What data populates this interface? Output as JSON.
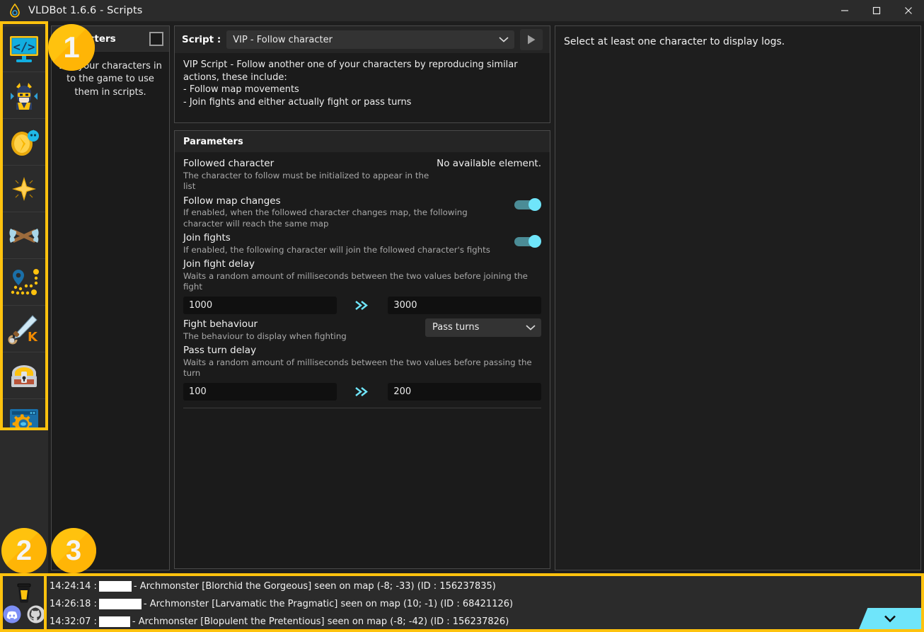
{
  "window": {
    "title": "VLDBot 1.6.6 - Scripts",
    "app_icon": "droplet-icon",
    "minimize_label": "—",
    "maximize_label": "□",
    "close_label": "✕"
  },
  "colors": {
    "accent_yellow": "#FFC20E",
    "accent_cyan": "#6FE5FA",
    "panel_bg": "#1B1B1B",
    "window_bg": "#1E1E1E",
    "header_bg": "#2B2B2B"
  },
  "sidebar": {
    "items": [
      {
        "id": "scripts",
        "label": "Scripts",
        "icon": "code-monitor-icon",
        "selected": true
      },
      {
        "id": "characters",
        "label": "Characters",
        "icon": "character-helmet-icon",
        "selected": false
      },
      {
        "id": "resources",
        "label": "Resources",
        "icon": "golden-egg-icon",
        "selected": false
      },
      {
        "id": "achievements",
        "label": "Achievements",
        "icon": "star-burst-icon",
        "selected": false
      },
      {
        "id": "fights",
        "label": "Fights",
        "icon": "crossed-axes-icon",
        "selected": false
      },
      {
        "id": "paths",
        "label": "Paths",
        "icon": "map-pin-path-icon",
        "selected": false
      },
      {
        "id": "kolizeum",
        "label": "Kolizeum",
        "icon": "sword-k-icon",
        "selected": false
      },
      {
        "id": "inventory",
        "label": "Inventory",
        "icon": "treasure-chest-icon",
        "selected": false
      },
      {
        "id": "settings",
        "label": "Settings",
        "icon": "window-gear-icon",
        "selected": false
      }
    ],
    "social": [
      {
        "id": "donate",
        "label": "Buy me a coffee",
        "icon": "coffee-cup-icon"
      },
      {
        "id": "discord",
        "label": "Discord",
        "icon": "discord-icon"
      },
      {
        "id": "github",
        "label": "GitHub",
        "icon": "github-icon"
      }
    ]
  },
  "characters_panel": {
    "title": "Characters",
    "select_all_checked": false,
    "empty_text": "Log your characters in to the game to use them in scripts."
  },
  "script_panel": {
    "script_label": "Script :",
    "selected_script": "VIP - Follow character",
    "dropdown_icon": "chevron-down-icon",
    "run_icon": "play-icon",
    "description": "VIP Script - Follow another one of your characters by reproducing similar actions, these include:\n - Follow map movements\n - Join fights and either actually fight or pass turns"
  },
  "parameters": {
    "title": "Parameters",
    "items": [
      {
        "type": "value",
        "name": "Followed character",
        "sub": "The character to follow must be initialized to appear in the list",
        "value": "No available element."
      },
      {
        "type": "toggle",
        "name": "Follow map changes",
        "sub": "If enabled, when the followed character changes map, the following character will reach the same map",
        "enabled": true
      },
      {
        "type": "toggle",
        "name": "Join fights",
        "sub": "If enabled, the following character will join the followed character's fights",
        "enabled": true
      },
      {
        "type": "range",
        "name": "Join fight delay",
        "sub": "Waits a random amount of milliseconds between the two values before joining the fight",
        "min_value": "1000",
        "max_value": "3000",
        "separator_icon": "double-chevron-right-icon"
      },
      {
        "type": "select",
        "name": "Fight behaviour",
        "sub": "The behaviour to display when fighting",
        "value": "Pass turns",
        "dropdown_icon": "chevron-down-icon"
      },
      {
        "type": "range",
        "name": "Pass turn delay",
        "sub": "Waits a random amount of milliseconds between the two values before passing the turn",
        "min_value": "100",
        "max_value": "200",
        "separator_icon": "double-chevron-right-icon"
      }
    ]
  },
  "right_panel": {
    "message": "Select at least one character to display logs."
  },
  "bottom_log": {
    "scroll_icon": "chevron-down-icon",
    "lines": [
      {
        "time": "14:24:14 :",
        "redacted_width": 46,
        "text": "- Archmonster [Blorchid the Gorgeous] seen on map (-8; -33) (ID : 156237835)"
      },
      {
        "time": "14:26:18 :",
        "redacted_width": 60,
        "text": "- Archmonster [Larvamatic the Pragmatic] seen on map (10; -1) (ID : 68421126)"
      },
      {
        "time": "14:32:07 :",
        "redacted_width": 44,
        "text": "- Archmonster [Blopulent the Pretentious] seen on map (-8; -42) (ID : 156237826)"
      }
    ]
  },
  "step_badges": [
    {
      "id": "badge-1",
      "number": "1"
    },
    {
      "id": "badge-2",
      "number": "2"
    },
    {
      "id": "badge-3",
      "number": "3"
    }
  ]
}
